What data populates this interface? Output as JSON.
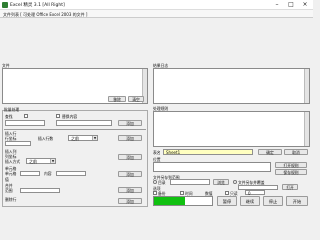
{
  "window": {
    "title": "Excel 精灵 3.1 [All Right]",
    "minimize": "–",
    "maximize": "□",
    "close": "×"
  },
  "menu": {
    "text": "文件列表 [ 可处理 Office Excel 2003 的文件 ]"
  },
  "file_panel": {
    "header": "文件",
    "delete_label": "移除",
    "clear_label": "清空"
  },
  "log_panel": {
    "header": "结果日志"
  },
  "left_tools": {
    "title": "批量处理",
    "find_label": "查找",
    "find_value": "",
    "replace_with_label": "替换内容",
    "replace_value": "",
    "apply_label": "添加",
    "insert_row": {
      "title": "插入行",
      "row_label": "行坐标",
      "count_label": "插入行数",
      "position_value": "之前",
      "add_label": "添加"
    },
    "insert_col": {
      "title": "插入列",
      "col_label": "列坐标",
      "method_label": "插入方式",
      "method_value": "之前",
      "add_label": "添加"
    },
    "cell_value": {
      "title": "单元格",
      "cell_label": "单元格",
      "content_label": "内容",
      "value_label": "值",
      "add_label": "添加"
    },
    "merge": {
      "title": "合并",
      "range_label": "范围",
      "add_label": "添加"
    },
    "delete_rows": {
      "title": "删除行",
      "add_label": "添加"
    }
  },
  "right_tools": {
    "title": "处理规则",
    "sheet_label": "表名",
    "sheet_value": "Sheet1",
    "confirm_label": "确定",
    "cancel_label": "取消",
    "position_label": "位置",
    "open_label": "打开规则",
    "save_label": "保存规则",
    "save_dir": {
      "title": "文件另存到范围",
      "dir_label": "目录",
      "dir_value": "",
      "browse_label": "浏览",
      "keep_label": "文件另存并覆盖",
      "keep_value": "",
      "open_folder_label": "打开"
    },
    "options": {
      "title": "选项",
      "backup_label": "备份",
      "time_label": "时间",
      "value_label": "数值",
      "only_label": "只读",
      "only_value": "0"
    },
    "progress": {
      "label": "处理进度",
      "value": 0.53
    },
    "buttons": {
      "pause": "暂停",
      "continue": "继续",
      "stop": "停止",
      "start": "开始"
    }
  },
  "colors": {
    "progress": "#10c010",
    "sheet_field": "#ffffc0"
  }
}
